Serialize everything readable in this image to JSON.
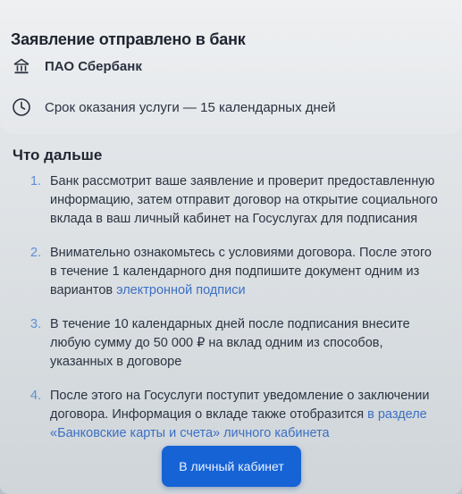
{
  "header": {
    "title": "Заявление отправлено в банк",
    "bank_name": "ПАО Сбербанк",
    "term_text": "Срок оказания услуги — 15 календарных дней"
  },
  "next_steps": {
    "title": "Что дальше",
    "items": [
      {
        "number": "1.",
        "text": "Банк рассмотрит ваше заявление и проверит предоставленную информацию, затем отправит договор на открытие социального вклада в ваш личный кабинет на Госуслугах для подписания"
      },
      {
        "number": "2.",
        "text": "Внимательно ознакомьтесь с условиями договора. После этого в течение 1 календарного дня подпишите документ одним из вариантов ",
        "link": "электронной подписи"
      },
      {
        "number": "3.",
        "text": "В течение 10 календарных дней после подписания внесите любую сумму до 50 000 ₽ на вклад одним из способов, указанных в договоре"
      },
      {
        "number": "4.",
        "text": "После этого на Госуслуги поступит уведомление о заключении договора. Информация о вкладе также отобразится ",
        "link": "в разделе «Банковские карты и счета» личного кабинета"
      }
    ]
  },
  "actions": {
    "cabinet_button": "В личный кабинет"
  },
  "icons": {
    "bank": "bank-icon",
    "clock": "clock-icon"
  },
  "colors": {
    "accent": "#1663d6",
    "link": "#3c6fc4",
    "step_number": "#5f8fd2"
  }
}
